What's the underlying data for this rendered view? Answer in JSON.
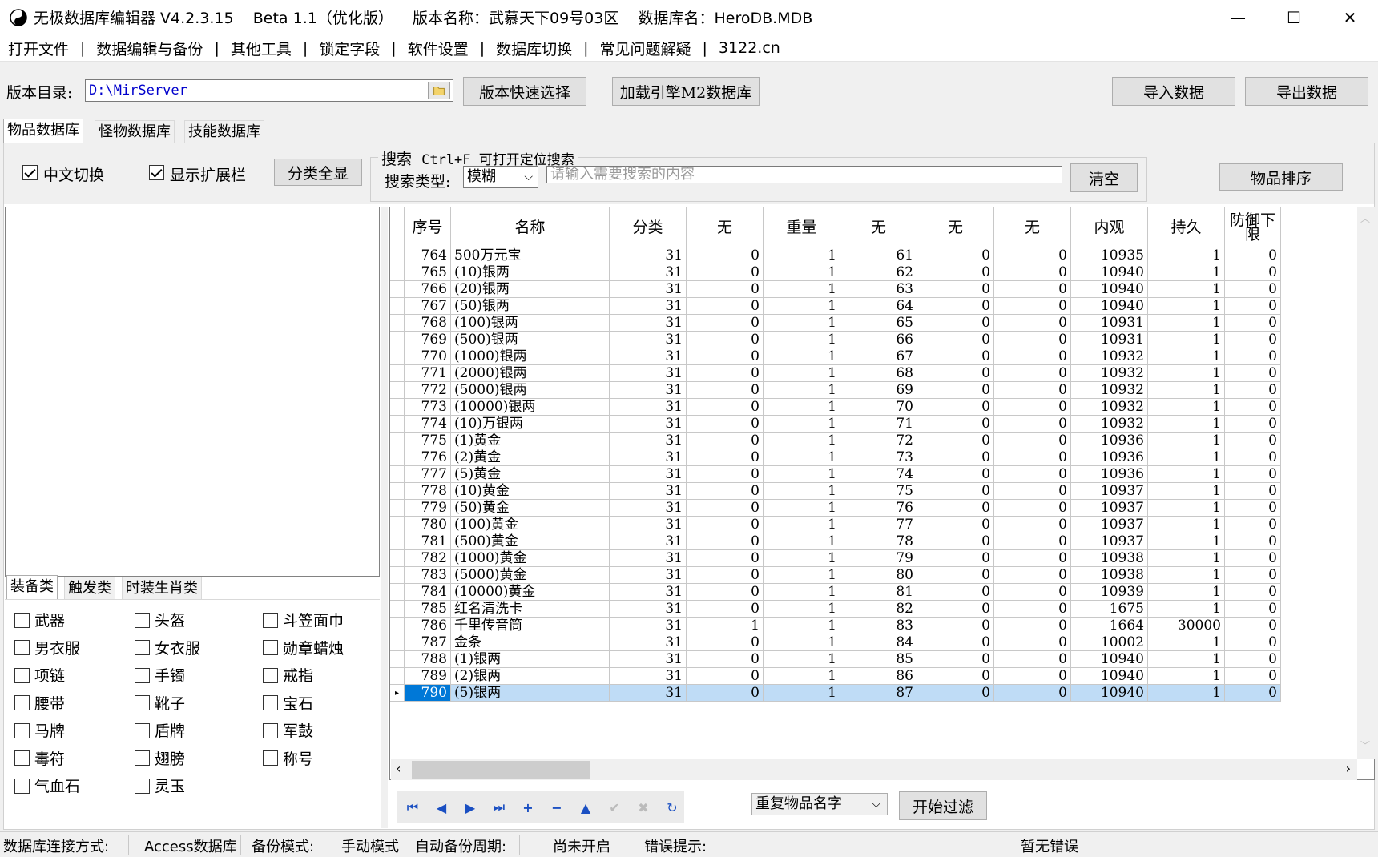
{
  "window": {
    "title": "无极数据库编辑器 V4.2.3.15    Beta 1.1（优化版）    版本名称：武慕天下09号03区    数据库名：HeroDB.MDB",
    "minimize": "—",
    "maximize": "☐",
    "close": "✕"
  },
  "menu": [
    "打开文件",
    "数据编辑与备份",
    "其他工具",
    "锁定字段",
    "软件设置",
    "数据库切换",
    "常见问题解疑",
    "3122.cn"
  ],
  "toolbar": {
    "dir_label": "版本目录:",
    "dir_value": "D:\\MirServer",
    "quick_select": "版本快速选择",
    "load_m2": "加载引擎M2数据库",
    "import": "导入数据",
    "export": "导出数据"
  },
  "tabs": [
    "物品数据库",
    "怪物数据库",
    "技能数据库"
  ],
  "filter": {
    "chinese_switch": "中文切换",
    "show_ext": "显示扩展栏",
    "show_all": "分类全显",
    "search_group": "搜索",
    "search_hint": "Ctrl+F 可打开定位搜索",
    "search_type_label": "搜索类型:",
    "search_type_value": "模糊",
    "search_placeholder": "请输入需要搜索的内容",
    "clear": "清空",
    "sort": "物品排序"
  },
  "category_tabs": [
    "装备类",
    "触发类",
    "时装生肖类"
  ],
  "categories": [
    "武器",
    "头盔",
    "斗笠面巾",
    "男衣服",
    "女衣服",
    "勋章蜡烛",
    "项链",
    "手镯",
    "戒指",
    "腰带",
    "靴子",
    "宝石",
    "马牌",
    "盾牌",
    "军鼓",
    "毒符",
    "翅膀",
    "称号",
    "气血石",
    "灵玉"
  ],
  "grid": {
    "columns": [
      "序号",
      "名称",
      "分类",
      "无",
      "重量",
      "无",
      "无",
      "无",
      "内观",
      "持久",
      "防御下限"
    ],
    "rows": [
      [
        "764",
        "500万元宝",
        "31",
        "0",
        "1",
        "61",
        "0",
        "0",
        "10935",
        "1",
        "0"
      ],
      [
        "765",
        "(10)银两",
        "31",
        "0",
        "1",
        "62",
        "0",
        "0",
        "10940",
        "1",
        "0"
      ],
      [
        "766",
        "(20)银两",
        "31",
        "0",
        "1",
        "63",
        "0",
        "0",
        "10940",
        "1",
        "0"
      ],
      [
        "767",
        "(50)银两",
        "31",
        "0",
        "1",
        "64",
        "0",
        "0",
        "10940",
        "1",
        "0"
      ],
      [
        "768",
        "(100)银两",
        "31",
        "0",
        "1",
        "65",
        "0",
        "0",
        "10931",
        "1",
        "0"
      ],
      [
        "769",
        "(500)银两",
        "31",
        "0",
        "1",
        "66",
        "0",
        "0",
        "10931",
        "1",
        "0"
      ],
      [
        "770",
        "(1000)银两",
        "31",
        "0",
        "1",
        "67",
        "0",
        "0",
        "10932",
        "1",
        "0"
      ],
      [
        "771",
        "(2000)银两",
        "31",
        "0",
        "1",
        "68",
        "0",
        "0",
        "10932",
        "1",
        "0"
      ],
      [
        "772",
        "(5000)银两",
        "31",
        "0",
        "1",
        "69",
        "0",
        "0",
        "10932",
        "1",
        "0"
      ],
      [
        "773",
        "(10000)银两",
        "31",
        "0",
        "1",
        "70",
        "0",
        "0",
        "10932",
        "1",
        "0"
      ],
      [
        "774",
        "(10)万银两",
        "31",
        "0",
        "1",
        "71",
        "0",
        "0",
        "10932",
        "1",
        "0"
      ],
      [
        "775",
        "(1)黄金",
        "31",
        "0",
        "1",
        "72",
        "0",
        "0",
        "10936",
        "1",
        "0"
      ],
      [
        "776",
        "(2)黄金",
        "31",
        "0",
        "1",
        "73",
        "0",
        "0",
        "10936",
        "1",
        "0"
      ],
      [
        "777",
        "(5)黄金",
        "31",
        "0",
        "1",
        "74",
        "0",
        "0",
        "10936",
        "1",
        "0"
      ],
      [
        "778",
        "(10)黄金",
        "31",
        "0",
        "1",
        "75",
        "0",
        "0",
        "10937",
        "1",
        "0"
      ],
      [
        "779",
        "(50)黄金",
        "31",
        "0",
        "1",
        "76",
        "0",
        "0",
        "10937",
        "1",
        "0"
      ],
      [
        "780",
        "(100)黄金",
        "31",
        "0",
        "1",
        "77",
        "0",
        "0",
        "10937",
        "1",
        "0"
      ],
      [
        "781",
        "(500)黄金",
        "31",
        "0",
        "1",
        "78",
        "0",
        "0",
        "10937",
        "1",
        "0"
      ],
      [
        "782",
        "(1000)黄金",
        "31",
        "0",
        "1",
        "79",
        "0",
        "0",
        "10938",
        "1",
        "0"
      ],
      [
        "783",
        "(5000)黄金",
        "31",
        "0",
        "1",
        "80",
        "0",
        "0",
        "10938",
        "1",
        "0"
      ],
      [
        "784",
        "(10000)黄金",
        "31",
        "0",
        "1",
        "81",
        "0",
        "0",
        "10939",
        "1",
        "0"
      ],
      [
        "785",
        "红名清洗卡",
        "31",
        "0",
        "1",
        "82",
        "0",
        "0",
        "1675",
        "1",
        "0"
      ],
      [
        "786",
        "千里传音筒",
        "31",
        "1",
        "1",
        "83",
        "0",
        "0",
        "1664",
        "30000",
        "0"
      ],
      [
        "787",
        "金条",
        "31",
        "0",
        "1",
        "84",
        "0",
        "0",
        "10002",
        "1",
        "0"
      ],
      [
        "788",
        "(1)银两",
        "31",
        "0",
        "1",
        "85",
        "0",
        "0",
        "10940",
        "1",
        "0"
      ],
      [
        "789",
        "(2)银两",
        "31",
        "0",
        "1",
        "86",
        "0",
        "0",
        "10940",
        "1",
        "0"
      ],
      [
        "790",
        "(5)银两",
        "31",
        "0",
        "1",
        "87",
        "0",
        "0",
        "10940",
        "1",
        "0"
      ]
    ],
    "selected_index": 26
  },
  "bottom": {
    "dup_select": "重复物品名字",
    "start_filter": "开始过滤",
    "nav_icons": [
      "first-icon",
      "prior-icon",
      "next-icon",
      "last-icon",
      "insert-icon",
      "delete-icon",
      "edit-icon",
      "post-icon",
      "cancel-icon",
      "refresh-icon"
    ]
  },
  "status": {
    "conn_label": "数据库连接方式:",
    "conn_value": "Access数据库",
    "backup_label": "备份模式:",
    "backup_value": "手动模式",
    "auto_label": "自动备份周期:",
    "auto_value": "尚未开启",
    "err_label": "错误提示:",
    "err_value": "暂无错误"
  }
}
